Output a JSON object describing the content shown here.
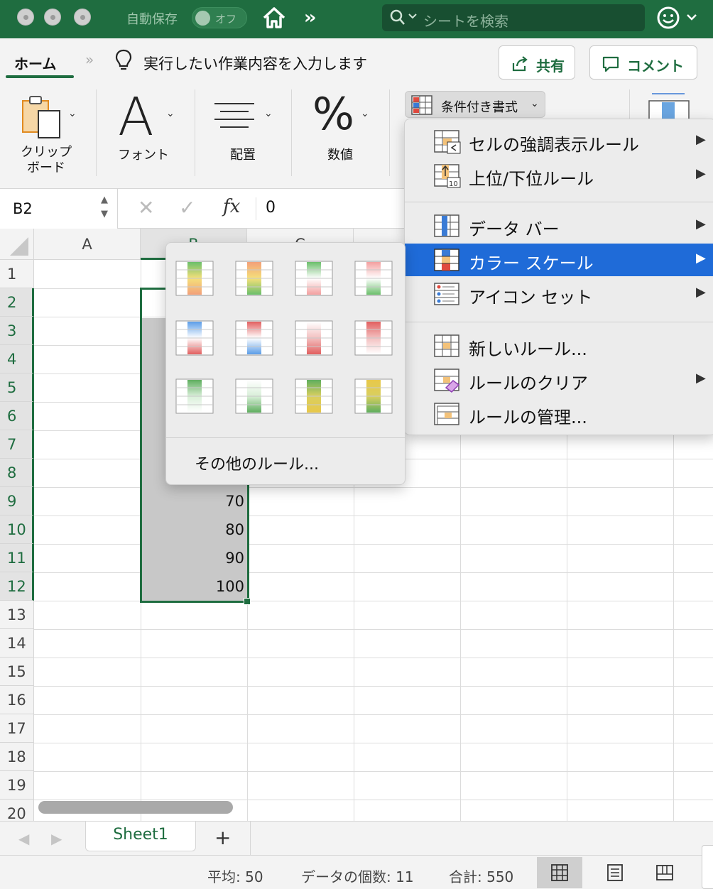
{
  "titlebar": {
    "autosave_label": "自動保存",
    "autosave_toggle": "オフ",
    "search_placeholder": "シートを検索"
  },
  "tellme": {
    "active_tab": "ホーム",
    "prompt": "実行したい作業内容を入力します",
    "share": "共有",
    "comment": "コメント"
  },
  "ribbon": {
    "clipboard_line1": "クリップ",
    "clipboard_line2": "ボード",
    "font": "フォント",
    "alignment": "配置",
    "number": "数値",
    "conditional_format": "条件付き書式"
  },
  "formula_bar": {
    "name_box": "B2",
    "fx": "fx",
    "value": "0"
  },
  "sheet": {
    "columns": [
      "A",
      "B",
      "C"
    ],
    "rows": [
      "1",
      "2",
      "3",
      "4",
      "5",
      "6",
      "7",
      "8",
      "9",
      "10",
      "11",
      "12",
      "13",
      "14",
      "15",
      "16",
      "17",
      "18",
      "19",
      "20"
    ],
    "visible_values": {
      "r9": "70",
      "r10": "80",
      "r11": "90",
      "r12": "100"
    }
  },
  "cf_menu": {
    "highlight_rules": "セルの強調表示ルール",
    "top_bottom": "上位/下位ルール",
    "data_bar": "データ バー",
    "color_scale": "カラー スケール",
    "icon_set": "アイコン セット",
    "new_rule": "新しいルール...",
    "clear_rules": "ルールのクリア",
    "manage_rules": "ルールの管理..."
  },
  "color_scale_sub": {
    "more_rules": "その他のルール..."
  },
  "tabs": {
    "sheet1": "Sheet1",
    "add": "+"
  },
  "status": {
    "average": "平均: 50",
    "count": "データの個数: 11",
    "sum": "合計: 550"
  },
  "colors": {
    "excel_green": "#1f6d40",
    "menu_highlight": "#1f6bd8"
  }
}
